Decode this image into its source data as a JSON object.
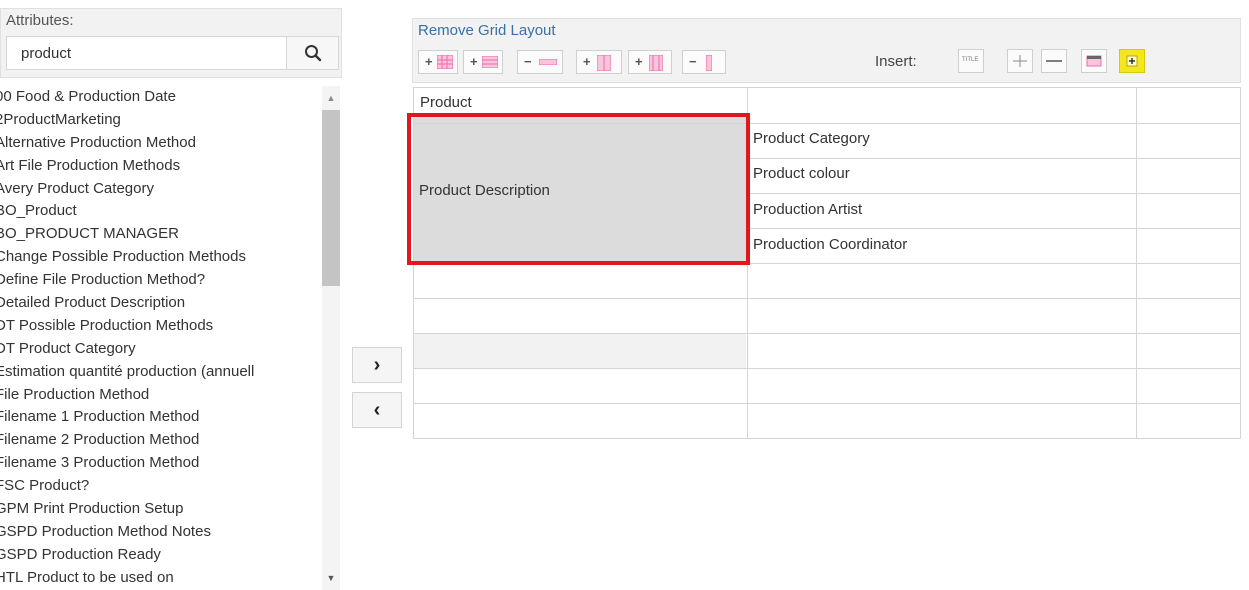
{
  "attributes_panel": {
    "label": "Attributes:",
    "search_value": "product",
    "items": [
      "00 Food & Production Date",
      "2ProductMarketing",
      "Alternative Production Method",
      "Art File Production Methods",
      "Avery Product Category",
      "BO_Product",
      "BO_PRODUCT MANAGER",
      "Change Possible Production Methods",
      "Define File Production Method?",
      "Detailed Product Description",
      "DT Possible Production Methods",
      "DT Product Category",
      "Estimation quantité production (annuell",
      "File Production Method",
      "Filename 1 Production Method",
      "Filename 2 Production Method",
      "Filename 3 Production Method",
      "FSC Product?",
      "GPM Print Production Setup",
      "GSPD Production Method Notes",
      "GSPD Production Ready",
      "HTL Product to be used on"
    ]
  },
  "move_buttons": {
    "right": "›",
    "left": "‹"
  },
  "toolbar": {
    "remove_grid_label": "Remove Grid Layout",
    "insert_label": "Insert:",
    "insert_title_label": "TITLE"
  },
  "grid": {
    "header": "Product",
    "merged_cell": "Product Description",
    "right_cells": [
      "Product Category",
      "Product colour",
      "Production Artist",
      "Production Coordinator"
    ]
  },
  "colors": {
    "highlight": "#e3161b",
    "toolbar_icon_pink": "#f06ca8",
    "insert_yellow": "#f5e71f"
  }
}
